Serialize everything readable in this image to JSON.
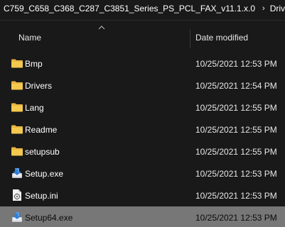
{
  "breadcrumb": {
    "path": "C759_C658_C368_C287_C3851_Series_PS_PCL_FAX_v11.1.x.0",
    "separator": "›",
    "current": "Driver"
  },
  "columns": {
    "name": "Name",
    "date_modified": "Date modified"
  },
  "colors": {
    "background": "#191919",
    "folder": "#f0c34a",
    "selected_row": "#777777"
  },
  "files": [
    {
      "name": "Bmp",
      "date": "10/25/2021 12:53 PM",
      "icon": "folder-icon",
      "selected": false
    },
    {
      "name": "Drivers",
      "date": "10/25/2021 12:54 PM",
      "icon": "folder-icon",
      "selected": false
    },
    {
      "name": "Lang",
      "date": "10/25/2021 12:55 PM",
      "icon": "folder-icon",
      "selected": false
    },
    {
      "name": "Readme",
      "date": "10/25/2021 12:55 PM",
      "icon": "folder-icon",
      "selected": false
    },
    {
      "name": "setupsub",
      "date": "10/25/2021 12:55 PM",
      "icon": "folder-icon",
      "selected": false
    },
    {
      "name": "Setup.exe",
      "date": "10/25/2021 12:53 PM",
      "icon": "installer-icon",
      "selected": false
    },
    {
      "name": "Setup.ini",
      "date": "10/25/2021 12:53 PM",
      "icon": "config-file-icon",
      "selected": false
    },
    {
      "name": "Setup64.exe",
      "date": "10/25/2021 12:53 PM",
      "icon": "installer-icon",
      "selected": true
    }
  ]
}
